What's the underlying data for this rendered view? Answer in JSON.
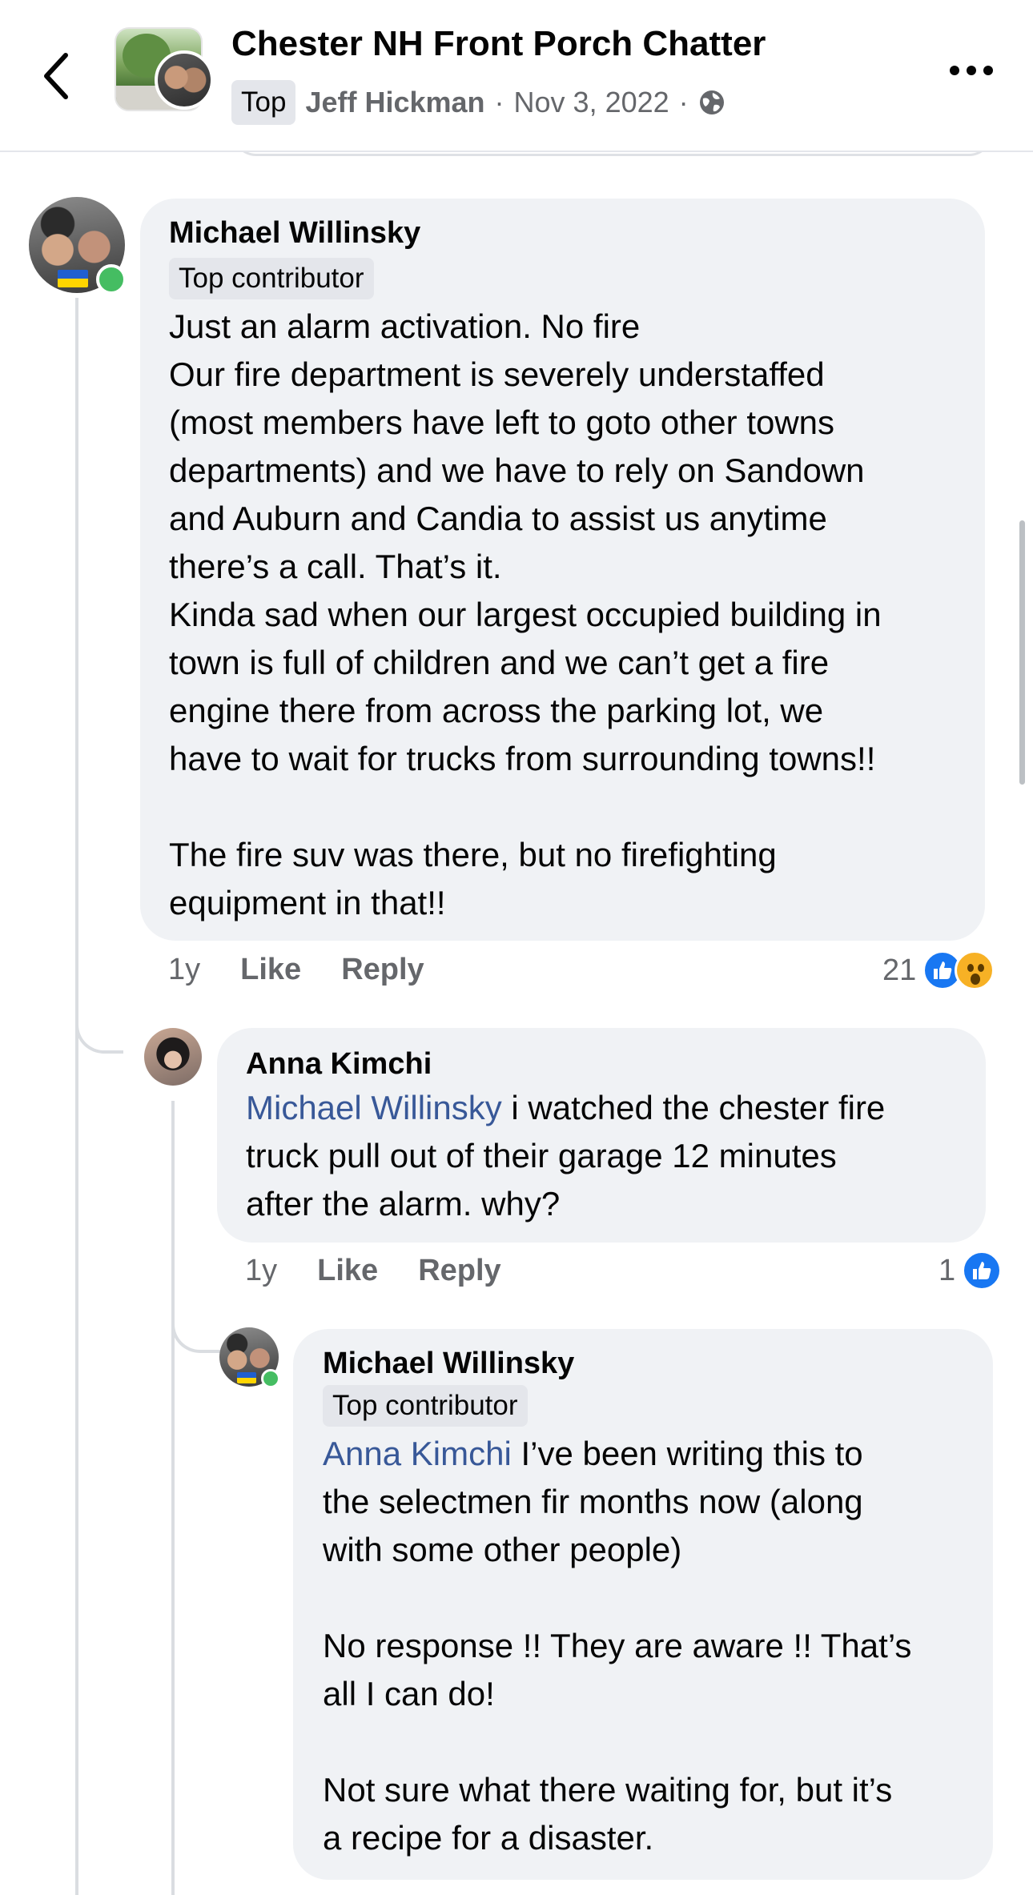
{
  "header": {
    "group_name": "Chester NH Front Porch Chatter",
    "badge": "Top",
    "author": "Jeff Hickman",
    "separator": "·",
    "date": "Nov 3, 2022",
    "privacy_icon": "globe-icon",
    "back_icon": "chevron-left-icon",
    "more_icon": "more-horizontal-icon"
  },
  "comments": [
    {
      "author": "Michael Willinsky",
      "badge": "Top contributor",
      "lines": [
        "Just an alarm activation. No fire",
        "Our fire department is severely understaffed",
        "(most members have left to goto other towns",
        "departments) and we have to rely on Sandown",
        "and Auburn and Candia to assist us anytime",
        "there’s a call. That’s it.",
        "Kinda sad when our largest occupied building in",
        "town is full of children and we can’t get a fire",
        "engine there from across the parking lot, we",
        "have to wait for trucks from surrounding towns!!",
        "The fire suv was there, but no firefighting",
        "equipment in that!!"
      ],
      "time": "1y",
      "like_label": "Like",
      "reply_label": "Reply",
      "reaction_count": "21",
      "reactions": [
        "like",
        "wow"
      ]
    },
    {
      "author": "Anna Kimchi",
      "mention": "Michael Willinsky",
      "lines": [
        " i watched the chester fire",
        "truck pull out of their garage 12 minutes",
        "after the alarm. why?"
      ],
      "time": "1y",
      "like_label": "Like",
      "reply_label": "Reply",
      "reaction_count": "1",
      "reactions": [
        "like"
      ]
    },
    {
      "author": "Michael Willinsky",
      "badge": "Top contributor",
      "mention": "Anna Kimchi",
      "lines": [
        " I’ve been writing this to",
        "the selectmen fir months now (along",
        "with some other people)",
        "No response !! They are aware !! That’s",
        "all I can do!",
        "Not sure what there waiting for, but it’s",
        "a recipe for a disaster."
      ]
    }
  ],
  "colors": {
    "bubble": "#f0f2f5",
    "mention": "#385898",
    "like_blue": "#1877f2",
    "online_green": "#45bd62",
    "secondary_text": "#65676b"
  }
}
